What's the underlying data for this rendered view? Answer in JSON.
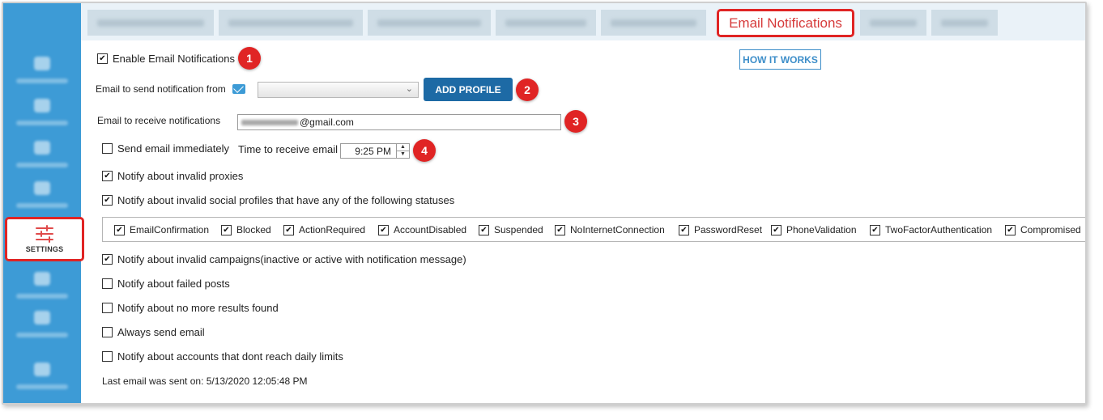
{
  "sidebar": {
    "settings_label": "SETTINGS"
  },
  "tabs": {
    "active_label": "Email Notifications"
  },
  "header": {
    "how_it_works": "HOW IT WORKS"
  },
  "settings": {
    "enable_label": "Enable Email Notifications",
    "enable_checked": true,
    "send_from_label": "Email to send notification from",
    "send_from_value": "",
    "add_profile": "ADD PROFILE",
    "receive_label": "Email to receive notifications",
    "receive_value": "@gmail.com",
    "send_immediately_label": "Send email immediately",
    "send_immediately_checked": false,
    "time_label": "Time to receive email",
    "time_value": "9:25 PM",
    "invalid_proxies_label": "Notify about invalid proxies",
    "invalid_profiles_label": "Notify about invalid social profiles that have any of the following statuses",
    "statuses": [
      "EmailConfirmation",
      "Blocked",
      "ActionRequired",
      "AccountDisabled",
      "Suspended",
      "NoInternetConnection",
      "PasswordReset",
      "PhoneValidation",
      "TwoFactorAuthentication",
      "Compromised"
    ],
    "invalid_campaigns_label": "Notify about invalid campaigns(inactive or active with notification message)",
    "failed_posts_label": "Notify about failed posts",
    "no_results_label": "Notify about no more results found",
    "always_send_label": "Always send email",
    "daily_limits_label": "Notify about accounts that dont reach daily limits",
    "last_sent": "Last email was sent on: 5/13/2020 12:05:48 PM"
  },
  "badges": [
    "1",
    "2",
    "3",
    "4"
  ],
  "colors": {
    "sidebar": "#3d9bd6",
    "highlight": "#e02424",
    "primary_button": "#1d6aa5"
  }
}
